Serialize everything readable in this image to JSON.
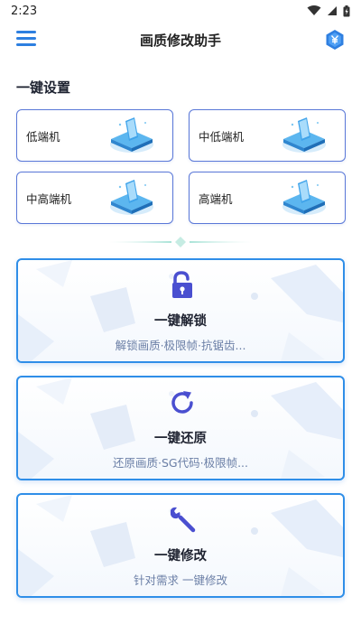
{
  "status": {
    "time": "2:23"
  },
  "app_bar": {
    "title": "画质修改助手"
  },
  "presets": {
    "heading": "一键设置",
    "items": [
      {
        "label": "低端机"
      },
      {
        "label": "中低端机"
      },
      {
        "label": "中高端机"
      },
      {
        "label": "高端机"
      }
    ]
  },
  "actions": [
    {
      "title": "一键解锁",
      "subtitle": "解锁画质·极限帧·抗锯齿...",
      "icon": "unlock-icon"
    },
    {
      "title": "一键还原",
      "subtitle": "还原画质·SG代码·极限帧...",
      "icon": "refresh-icon"
    },
    {
      "title": "一键修改",
      "subtitle": "针对需求 一键修改",
      "icon": "wrench-icon"
    }
  ],
  "colors": {
    "accent": "#2f8ee8",
    "icon_purple": "#4a4fd0",
    "preset_border": "#5a78d8"
  }
}
